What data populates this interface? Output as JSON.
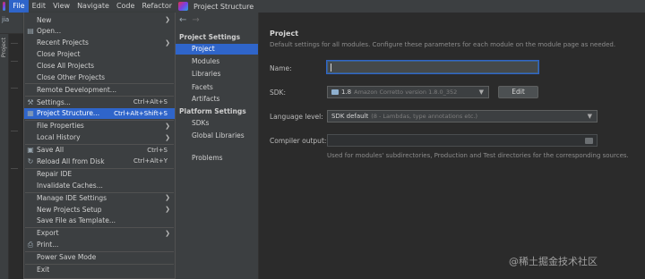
{
  "menubar": {
    "items": [
      {
        "label": "File",
        "active": true
      },
      {
        "label": "Edit"
      },
      {
        "label": "View"
      },
      {
        "label": "Navigate"
      },
      {
        "label": "Code"
      },
      {
        "label": "Refactor"
      }
    ]
  },
  "ide": {
    "toolbar_text": "jia",
    "stripe_label": "Project"
  },
  "file_menu": {
    "items": [
      {
        "label": "New",
        "shortcut": "",
        "arrow": true,
        "icon": ""
      },
      {
        "label": "Open...",
        "shortcut": "",
        "arrow": false,
        "icon": "folder-open-icon"
      },
      {
        "label": "Recent Projects",
        "shortcut": "",
        "arrow": true,
        "icon": ""
      },
      {
        "label": "Close Project",
        "shortcut": "",
        "arrow": false,
        "icon": ""
      },
      {
        "label": "Close All Projects",
        "shortcut": "",
        "arrow": false,
        "icon": ""
      },
      {
        "label": "Close Other Projects",
        "shortcut": "",
        "arrow": false,
        "icon": ""
      },
      {
        "label": "Remote Development...",
        "shortcut": "",
        "arrow": false,
        "icon": ""
      },
      {
        "label": "Settings...",
        "shortcut": "Ctrl+Alt+S",
        "arrow": false,
        "icon": "wrench-icon"
      },
      {
        "label": "Project Structure...",
        "shortcut": "Ctrl+Alt+Shift+S",
        "arrow": false,
        "icon": "project-structure-icon",
        "highlight": true
      },
      {
        "label": "File Properties",
        "shortcut": "",
        "arrow": true,
        "icon": ""
      },
      {
        "label": "Local History",
        "shortcut": "",
        "arrow": true,
        "icon": ""
      },
      {
        "label": "Save All",
        "shortcut": "Ctrl+S",
        "arrow": false,
        "icon": "save-icon"
      },
      {
        "label": "Reload All from Disk",
        "shortcut": "Ctrl+Alt+Y",
        "arrow": false,
        "icon": "reload-icon"
      },
      {
        "label": "Repair IDE",
        "shortcut": "",
        "arrow": false,
        "icon": ""
      },
      {
        "label": "Invalidate Caches...",
        "shortcut": "",
        "arrow": false,
        "icon": ""
      },
      {
        "label": "Manage IDE Settings",
        "shortcut": "",
        "arrow": true,
        "icon": ""
      },
      {
        "label": "New Projects Setup",
        "shortcut": "",
        "arrow": true,
        "icon": ""
      },
      {
        "label": "Save File as Template...",
        "shortcut": "",
        "arrow": false,
        "icon": ""
      },
      {
        "label": "Export",
        "shortcut": "",
        "arrow": true,
        "icon": ""
      },
      {
        "label": "Print...",
        "shortcut": "",
        "arrow": false,
        "icon": "print-icon"
      },
      {
        "label": "Power Save Mode",
        "shortcut": "",
        "arrow": false,
        "icon": ""
      },
      {
        "label": "Exit",
        "shortcut": "",
        "arrow": false,
        "icon": ""
      }
    ]
  },
  "dialog": {
    "title": "Project Structure",
    "sidebar": {
      "project_settings_header": "Project Settings",
      "project_settings": [
        "Project",
        "Modules",
        "Libraries",
        "Facets",
        "Artifacts"
      ],
      "platform_settings_header": "Platform Settings",
      "platform_settings": [
        "SDKs",
        "Global Libraries"
      ],
      "problems": "Problems",
      "selected": "Project"
    },
    "content": {
      "title": "Project",
      "description": "Default settings for all modules. Configure these parameters for each module on the module page as needed.",
      "name_label": "Name:",
      "name_value": "",
      "sdk_label": "SDK:",
      "sdk_version": "1.8",
      "sdk_detail": "Amazon Corretto version 1.8.0_352",
      "edit_button": "Edit",
      "language_level_label": "Language level:",
      "language_level_value": "SDK default",
      "language_level_detail": "(8 - Lambdas, type annotations etc.)",
      "compiler_output_label": "Compiler output:",
      "compiler_output_value": "",
      "compiler_output_hint": "Used for modules' subdirectories, Production and Test directories for the corresponding sources."
    }
  },
  "watermark": "@稀土掘金技术社区"
}
